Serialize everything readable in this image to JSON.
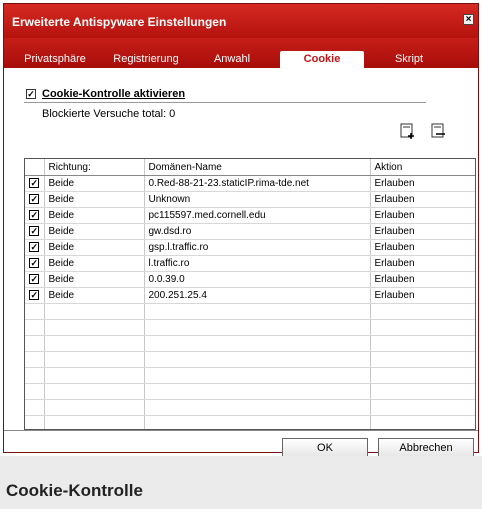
{
  "dialog": {
    "title": "Erweiterte Antispyware Einstellungen",
    "close_icon": "close-icon"
  },
  "tabs": [
    {
      "label": "Privatsphäre",
      "active": false
    },
    {
      "label": "Registrierung",
      "active": false
    },
    {
      "label": "Anwahl",
      "active": false
    },
    {
      "label": "Cookie",
      "active": true
    },
    {
      "label": "Skript",
      "active": false
    }
  ],
  "cookie_control": {
    "checkbox_checked": true,
    "label": "Cookie-Kontrolle aktivieren",
    "blocked_info": "Blockierte Versuche total: 0"
  },
  "toolbar": {
    "add_icon": "add-entry-icon",
    "remove_icon": "remove-entry-icon"
  },
  "table": {
    "headers": [
      "Richtung:",
      "Domänen-Name",
      "Aktion"
    ],
    "rows": [
      {
        "checked": true,
        "direction": "Beide",
        "domain": "0.Red-88-21-23.staticIP.rima-tde.net",
        "action": "Erlauben"
      },
      {
        "checked": true,
        "direction": "Beide",
        "domain": "Unknown",
        "action": "Erlauben"
      },
      {
        "checked": true,
        "direction": "Beide",
        "domain": "pc115597.med.cornell.edu",
        "action": "Erlauben"
      },
      {
        "checked": true,
        "direction": "Beide",
        "domain": "gw.dsd.ro",
        "action": "Erlauben"
      },
      {
        "checked": true,
        "direction": "Beide",
        "domain": "gsp.l.traffic.ro",
        "action": "Erlauben"
      },
      {
        "checked": true,
        "direction": "Beide",
        "domain": "l.traffic.ro",
        "action": "Erlauben"
      },
      {
        "checked": true,
        "direction": "Beide",
        "domain": "0.0.39.0",
        "action": "Erlauben"
      },
      {
        "checked": true,
        "direction": "Beide",
        "domain": "200.251.25.4",
        "action": "Erlauben"
      }
    ]
  },
  "buttons": {
    "ok": "OK",
    "cancel": "Abbrechen"
  },
  "caption": "Cookie-Kontrolle",
  "colors": {
    "titlebar": "#c61e18",
    "active_tab_text": "#c01414"
  }
}
